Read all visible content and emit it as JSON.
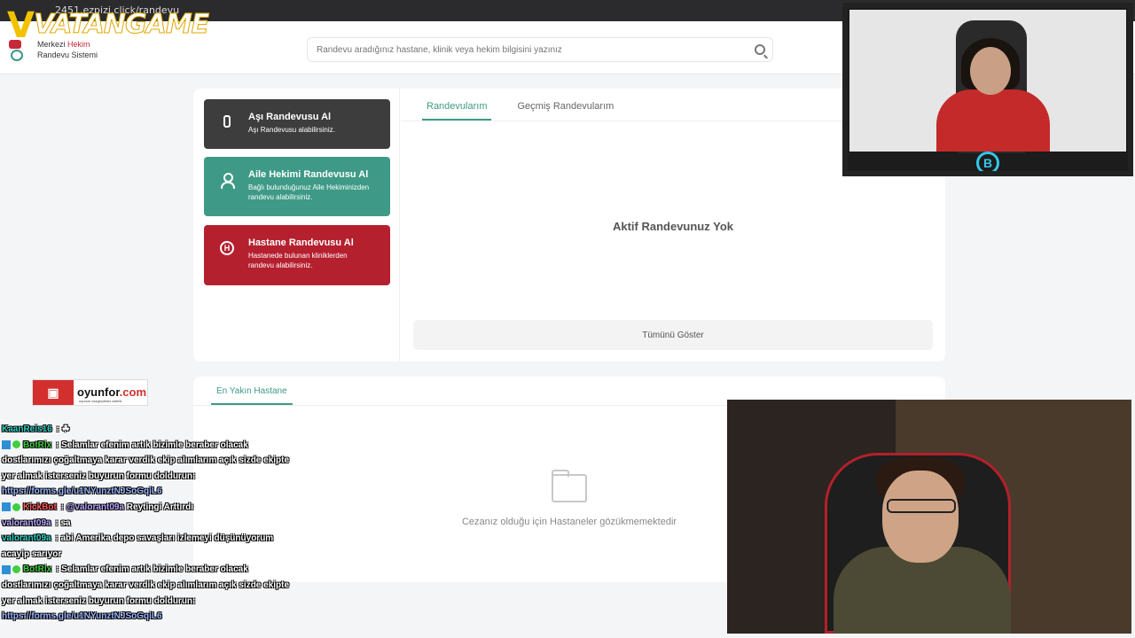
{
  "browser": {
    "url": "2451.ezpizi.click/randevu"
  },
  "stream": {
    "brand": "VATANGAME",
    "brand_v": "V",
    "sponsor": {
      "name": "oyunfor",
      "tld": ".com",
      "tagline": "oyunun vazgeçilmez adresi"
    },
    "cam_logo": "B"
  },
  "header": {
    "logo_line1_a": "Merkezi ",
    "logo_line1_b": "Hekim",
    "logo_line2": "Randevu Sistemi",
    "search_placeholder": "Randevu aradığınız hastane, klinik veya hekim bilgisini yazınız"
  },
  "actions": [
    {
      "title": "Aşı Randevusu Al",
      "desc": "Aşı Randevusu alabilirsiniz."
    },
    {
      "title": "Aile Hekimi Randevusu Al",
      "desc": "Bağlı bulunduğunuz Aile Hekiminizden randevu alabilirsiniz."
    },
    {
      "title": "Hastane Randevusu Al",
      "desc": "Hastanede bulunan kliniklerden randevu alabilirsiniz."
    }
  ],
  "tabs": {
    "active": "Randevularım",
    "past": "Geçmiş Randevularım"
  },
  "appointments": {
    "empty": "Aktif Randevunuz Yok",
    "show_all": "Tümünü Göster"
  },
  "nearest": {
    "tab": "En Yakın Hastane",
    "message": "Cezanız olduğu için Hastaneler gözükmemektedir"
  },
  "chat": [
    {
      "user": "KaanReis16",
      "color": "#30d0c8",
      "text": " : ☘",
      "mod": false
    },
    {
      "user": "BotRix",
      "color": "#3ecf3e",
      "text": " : Selamlar efenim artık bizimle beraber olacak dostlarımızı çoğaltmaya karar verdik ekip alımlarım açık sizde ekipte yer almak isterseniz buyurun formu doldurun:",
      "mod": true
    },
    {
      "link": "https://forms.gle/u1NYunztNJSoGqiL6"
    },
    {
      "user": "KickBot",
      "color": "#ff5a5a",
      "text": " Reytingi Arttırdı",
      "mention": " : @valorant09a",
      "mod": true
    },
    {
      "user": "valorant09a",
      "color": "#b9a6ff",
      "text": " : sa",
      "mod": false
    },
    {
      "user": "valorant09a",
      "color": "#30d0c8",
      "text": " : abi Amerika depo savaşları izlemeyi düşünüyorum acayip sarıyor",
      "mod": false
    },
    {
      "user": "BotRix",
      "color": "#3ecf3e",
      "text": " : Selamlar efenim artık bizimle beraber olacak dostlarımızı çoğaltmaya karar verdik ekip alımlarım açık sizde ekipte yer almak isterseniz buyurun formu doldurun:",
      "mod": true
    },
    {
      "link": "https://forms.gle/u1NYunztNJSoGqiL6"
    }
  ],
  "colors": {
    "accent": "#3e9a86",
    "danger": "#b5202f",
    "dark": "#3d3d3d"
  }
}
